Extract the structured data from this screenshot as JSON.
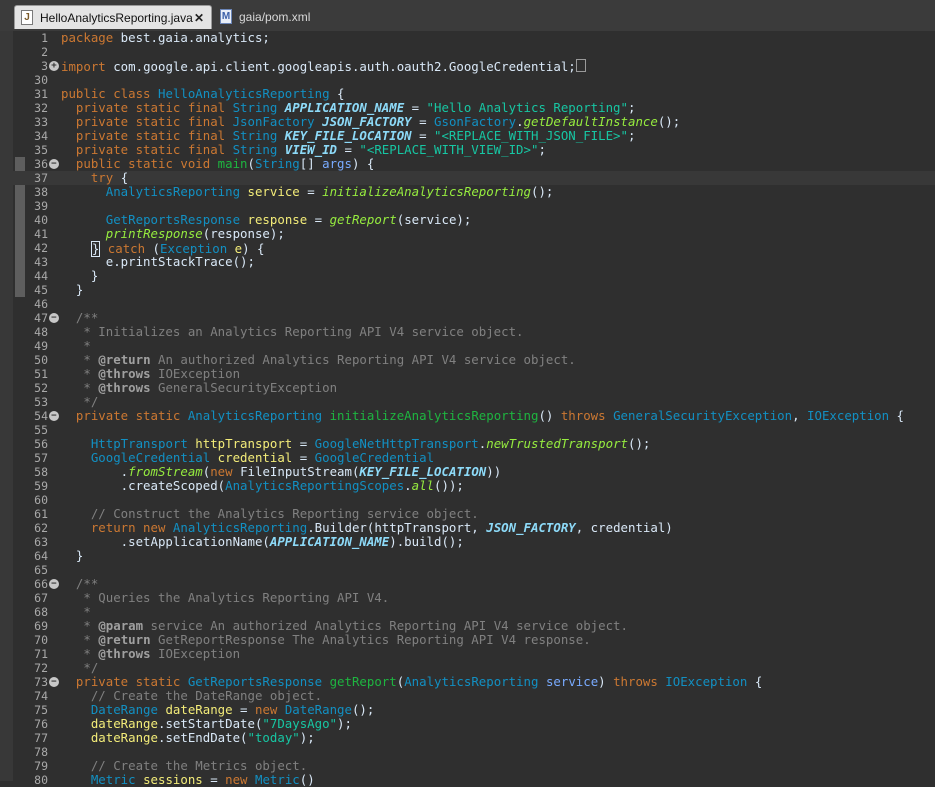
{
  "tabs": [
    {
      "label": "HelloAnalyticsReporting.java",
      "icon": "java-file-icon",
      "active": true
    },
    {
      "label": "gaia/pom.xml",
      "icon": "maven-file-icon",
      "active": false
    }
  ],
  "lines": [
    {
      "n": "1",
      "t": [
        [
          "k",
          "package"
        ],
        [
          "pl",
          " best.gaia.analytics;"
        ]
      ]
    },
    {
      "n": "2",
      "t": []
    },
    {
      "n": "3",
      "f": "+",
      "t": [
        [
          "k",
          "import"
        ],
        [
          "pl",
          " com.google.api.client.googleapis.auth.oauth2.GoogleCredential;"
        ],
        [
          "box",
          ""
        ]
      ]
    },
    {
      "n": "30",
      "t": []
    },
    {
      "n": "31",
      "t": [
        [
          "k",
          "public class "
        ],
        [
          "ty",
          "HelloAnalyticsReporting"
        ],
        [
          "pl",
          " {"
        ]
      ]
    },
    {
      "n": "32",
      "t": [
        [
          "pl",
          "  "
        ],
        [
          "k",
          "private static final "
        ],
        [
          "ty",
          "String "
        ],
        [
          "cn",
          "APPLICATION_NAME"
        ],
        [
          "pl",
          " = "
        ],
        [
          "st",
          "\"Hello Analytics Reporting\""
        ],
        [
          "pl",
          ";"
        ]
      ]
    },
    {
      "n": "33",
      "t": [
        [
          "pl",
          "  "
        ],
        [
          "k",
          "private static final "
        ],
        [
          "ty",
          "JsonFactory "
        ],
        [
          "cn",
          "JSON_FACTORY"
        ],
        [
          "pl",
          " = "
        ],
        [
          "ty",
          "GsonFactory"
        ],
        [
          "pl",
          "."
        ],
        [
          "sm",
          "getDefaultInstance"
        ],
        [
          "pl",
          "();"
        ]
      ]
    },
    {
      "n": "34",
      "t": [
        [
          "pl",
          "  "
        ],
        [
          "k",
          "private static final "
        ],
        [
          "ty",
          "String "
        ],
        [
          "cn",
          "KEY_FILE_LOCATION"
        ],
        [
          "pl",
          " = "
        ],
        [
          "st",
          "\"<REPLACE_WITH_JSON_FILE>\""
        ],
        [
          "pl",
          ";"
        ]
      ]
    },
    {
      "n": "35",
      "t": [
        [
          "pl",
          "  "
        ],
        [
          "k",
          "private static final "
        ],
        [
          "ty",
          "String "
        ],
        [
          "cn",
          "VIEW_ID"
        ],
        [
          "pl",
          " = "
        ],
        [
          "st",
          "\"<REPLACE_WITH_VIEW_ID>\""
        ],
        [
          "pl",
          ";"
        ]
      ]
    },
    {
      "n": "36",
      "f": "-",
      "t": [
        [
          "pl",
          "  "
        ],
        [
          "k",
          "public static void "
        ],
        [
          "fn",
          "main"
        ],
        [
          "pl",
          "("
        ],
        [
          "ty",
          "String"
        ],
        [
          "pl",
          "[] "
        ],
        [
          "pm",
          "args"
        ],
        [
          "pl",
          ") {"
        ]
      ]
    },
    {
      "n": "37",
      "cur": true,
      "t": [
        [
          "pl",
          "    "
        ],
        [
          "k",
          "try"
        ],
        [
          "pl",
          " {"
        ]
      ]
    },
    {
      "n": "38",
      "t": [
        [
          "pl",
          "      "
        ],
        [
          "ty",
          "AnalyticsReporting "
        ],
        [
          "var",
          "service"
        ],
        [
          "pl",
          " = "
        ],
        [
          "sm",
          "initializeAnalyticsReporting"
        ],
        [
          "pl",
          "();"
        ]
      ]
    },
    {
      "n": "39",
      "t": []
    },
    {
      "n": "40",
      "t": [
        [
          "pl",
          "      "
        ],
        [
          "ty",
          "GetReportsResponse "
        ],
        [
          "var",
          "response"
        ],
        [
          "pl",
          " = "
        ],
        [
          "sm",
          "getReport"
        ],
        [
          "pl",
          "(service);"
        ]
      ]
    },
    {
      "n": "41",
      "t": [
        [
          "pl",
          "      "
        ],
        [
          "sm",
          "printResponse"
        ],
        [
          "pl",
          "(response);"
        ]
      ]
    },
    {
      "n": "42",
      "t": [
        [
          "pl",
          "    "
        ],
        [
          "cursor",
          "}"
        ],
        [
          "pl",
          " "
        ],
        [
          "k",
          "catch"
        ],
        [
          "pl",
          " ("
        ],
        [
          "ty",
          "Exception "
        ],
        [
          "var",
          "e"
        ],
        [
          "pl",
          ") {"
        ]
      ]
    },
    {
      "n": "43",
      "t": [
        [
          "pl",
          "      e.printStackTrace();"
        ]
      ]
    },
    {
      "n": "44",
      "t": [
        [
          "pl",
          "    }"
        ]
      ]
    },
    {
      "n": "45",
      "t": [
        [
          "pl",
          "  }"
        ]
      ]
    },
    {
      "n": "46",
      "t": []
    },
    {
      "n": "47",
      "f": "-",
      "t": [
        [
          "cm",
          "  /**"
        ]
      ]
    },
    {
      "n": "48",
      "t": [
        [
          "cm",
          "   * Initializes an Analytics Reporting API V4 service object."
        ]
      ]
    },
    {
      "n": "49",
      "t": [
        [
          "cm",
          "   *"
        ]
      ]
    },
    {
      "n": "50",
      "t": [
        [
          "cm",
          "   * "
        ],
        [
          "ct",
          "@return"
        ],
        [
          "cm",
          " An authorized Analytics Reporting API V4 service object."
        ]
      ]
    },
    {
      "n": "51",
      "t": [
        [
          "cm",
          "   * "
        ],
        [
          "ct",
          "@throws"
        ],
        [
          "cm",
          " IOException"
        ]
      ]
    },
    {
      "n": "52",
      "t": [
        [
          "cm",
          "   * "
        ],
        [
          "ct",
          "@throws"
        ],
        [
          "cm",
          " GeneralSecurityException"
        ]
      ]
    },
    {
      "n": "53",
      "t": [
        [
          "cm",
          "   */"
        ]
      ]
    },
    {
      "n": "54",
      "f": "-",
      "t": [
        [
          "pl",
          "  "
        ],
        [
          "k",
          "private static "
        ],
        [
          "ty",
          "AnalyticsReporting "
        ],
        [
          "fn",
          "initializeAnalyticsReporting"
        ],
        [
          "pl",
          "() "
        ],
        [
          "k",
          "throws "
        ],
        [
          "ty",
          "GeneralSecurityException"
        ],
        [
          "pl",
          ", "
        ],
        [
          "ty",
          "IOException"
        ],
        [
          "pl",
          " {"
        ]
      ]
    },
    {
      "n": "55",
      "t": []
    },
    {
      "n": "56",
      "t": [
        [
          "pl",
          "    "
        ],
        [
          "ty",
          "HttpTransport "
        ],
        [
          "var",
          "httpTransport"
        ],
        [
          "pl",
          " = "
        ],
        [
          "ty",
          "GoogleNetHttpTransport"
        ],
        [
          "pl",
          "."
        ],
        [
          "sm",
          "newTrustedTransport"
        ],
        [
          "pl",
          "();"
        ]
      ]
    },
    {
      "n": "57",
      "t": [
        [
          "pl",
          "    "
        ],
        [
          "ty",
          "GoogleCredential "
        ],
        [
          "var",
          "credential"
        ],
        [
          "pl",
          " = "
        ],
        [
          "ty",
          "GoogleCredential"
        ]
      ]
    },
    {
      "n": "58",
      "t": [
        [
          "pl",
          "        ."
        ],
        [
          "sm",
          "fromStream"
        ],
        [
          "pl",
          "("
        ],
        [
          "k",
          "new "
        ],
        [
          "pl",
          "FileInputStream("
        ],
        [
          "cn",
          "KEY_FILE_LOCATION"
        ],
        [
          "pl",
          "))"
        ]
      ]
    },
    {
      "n": "59",
      "t": [
        [
          "pl",
          "        .createScoped("
        ],
        [
          "ty",
          "AnalyticsReportingScopes"
        ],
        [
          "pl",
          "."
        ],
        [
          "sm",
          "all"
        ],
        [
          "pl",
          "());"
        ]
      ]
    },
    {
      "n": "60",
      "t": []
    },
    {
      "n": "61",
      "t": [
        [
          "cm",
          "    // Construct the Analytics Reporting service object."
        ]
      ]
    },
    {
      "n": "62",
      "t": [
        [
          "pl",
          "    "
        ],
        [
          "k",
          "return new "
        ],
        [
          "ty",
          "AnalyticsReporting"
        ],
        [
          "pl",
          ".Builder(httpTransport, "
        ],
        [
          "cn",
          "JSON_FACTORY"
        ],
        [
          "pl",
          ", credential)"
        ]
      ]
    },
    {
      "n": "63",
      "t": [
        [
          "pl",
          "        .setApplicationName("
        ],
        [
          "cn",
          "APPLICATION_NAME"
        ],
        [
          "pl",
          ").build();"
        ]
      ]
    },
    {
      "n": "64",
      "t": [
        [
          "pl",
          "  }"
        ]
      ]
    },
    {
      "n": "65",
      "t": []
    },
    {
      "n": "66",
      "f": "-",
      "t": [
        [
          "cm",
          "  /**"
        ]
      ]
    },
    {
      "n": "67",
      "t": [
        [
          "cm",
          "   * Queries the Analytics Reporting API V4."
        ]
      ]
    },
    {
      "n": "68",
      "t": [
        [
          "cm",
          "   *"
        ]
      ]
    },
    {
      "n": "69",
      "t": [
        [
          "cm",
          "   * "
        ],
        [
          "ct",
          "@param"
        ],
        [
          "cm",
          " service An authorized Analytics Reporting API V4 service object."
        ]
      ]
    },
    {
      "n": "70",
      "t": [
        [
          "cm",
          "   * "
        ],
        [
          "ct",
          "@return"
        ],
        [
          "cm",
          " GetReportResponse The Analytics Reporting API V4 response."
        ]
      ]
    },
    {
      "n": "71",
      "t": [
        [
          "cm",
          "   * "
        ],
        [
          "ct",
          "@throws"
        ],
        [
          "cm",
          " IOException"
        ]
      ]
    },
    {
      "n": "72",
      "t": [
        [
          "cm",
          "   */"
        ]
      ]
    },
    {
      "n": "73",
      "f": "-",
      "t": [
        [
          "pl",
          "  "
        ],
        [
          "k",
          "private static "
        ],
        [
          "ty",
          "GetReportsResponse "
        ],
        [
          "fn",
          "getReport"
        ],
        [
          "pl",
          "("
        ],
        [
          "ty",
          "AnalyticsReporting "
        ],
        [
          "pm",
          "service"
        ],
        [
          "pl",
          ") "
        ],
        [
          "k",
          "throws "
        ],
        [
          "ty",
          "IOException"
        ],
        [
          "pl",
          " {"
        ]
      ]
    },
    {
      "n": "74",
      "t": [
        [
          "cm",
          "    // Create the DateRange object."
        ]
      ]
    },
    {
      "n": "75",
      "t": [
        [
          "pl",
          "    "
        ],
        [
          "ty",
          "DateRange "
        ],
        [
          "var",
          "dateRange"
        ],
        [
          "pl",
          " = "
        ],
        [
          "k",
          "new "
        ],
        [
          "ty",
          "DateRange"
        ],
        [
          "pl",
          "();"
        ]
      ]
    },
    {
      "n": "76",
      "t": [
        [
          "pl",
          "    "
        ],
        [
          "var",
          "dateRange"
        ],
        [
          "pl",
          ".setStartDate("
        ],
        [
          "st",
          "\"7DaysAgo\""
        ],
        [
          "pl",
          ");"
        ]
      ]
    },
    {
      "n": "77",
      "t": [
        [
          "pl",
          "    "
        ],
        [
          "var",
          "dateRange"
        ],
        [
          "pl",
          ".setEndDate("
        ],
        [
          "st",
          "\"today\""
        ],
        [
          "pl",
          ");"
        ]
      ]
    },
    {
      "n": "78",
      "t": []
    },
    {
      "n": "79",
      "t": [
        [
          "cm",
          "    // Create the Metrics object."
        ]
      ]
    },
    {
      "n": "80",
      "t": [
        [
          "pl",
          "    "
        ],
        [
          "ty",
          "Metric "
        ],
        [
          "var",
          "sessions"
        ],
        [
          "pl",
          " = "
        ],
        [
          "k",
          "new "
        ],
        [
          "ty",
          "Metric"
        ],
        [
          "pl",
          "()"
        ]
      ]
    }
  ]
}
